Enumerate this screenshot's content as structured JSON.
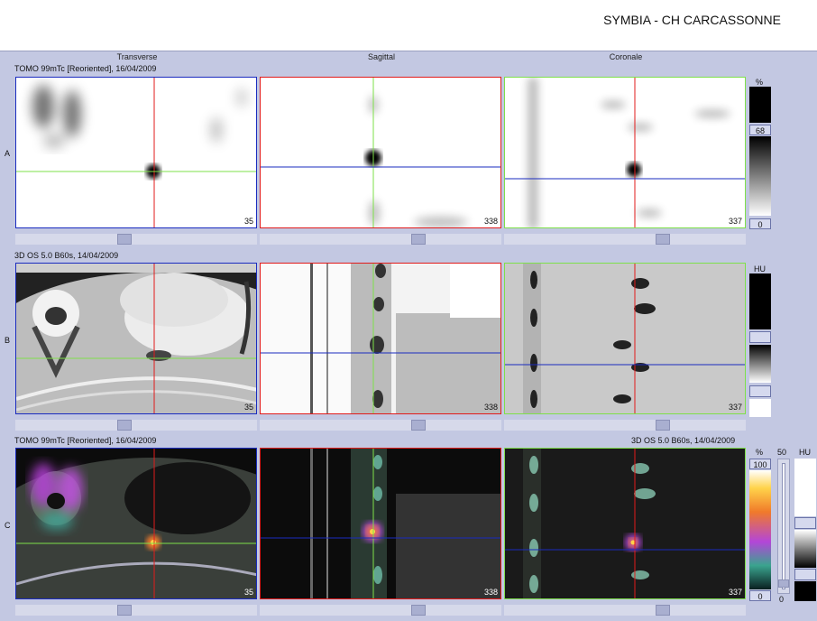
{
  "header": {
    "title": "SYMBIA - CH CARCASSONNE"
  },
  "columns": [
    "Transverse",
    "Sagittal",
    "Coronale"
  ],
  "rows": [
    {
      "label": "A",
      "series": "TOMO 99mTc [Reoriented], 16/04/2009",
      "series_right": "",
      "slices": [
        "35",
        "338",
        "337"
      ]
    },
    {
      "label": "B",
      "series": "3D  OS  5.0  B60s, 14/04/2009",
      "series_right": "",
      "slices": [
        "35",
        "338",
        "337"
      ]
    },
    {
      "label": "C",
      "series": "TOMO 99mTc [Reoriented], 16/04/2009",
      "series_right": "3D  OS  5.0  B60s, 14/04/2009",
      "slices": [
        "35",
        "338",
        "337"
      ]
    }
  ],
  "scales": {
    "a": {
      "unit": "%",
      "value": "68",
      "min": "0"
    },
    "b": {
      "unit": "HU"
    },
    "c": {
      "unit": "%",
      "max": "100",
      "min": "0",
      "blend": "50",
      "unit2": "HU",
      "blend_min": "0"
    }
  },
  "colors": {
    "crosshair_red": "#e11b1b",
    "crosshair_green": "#7ee04a",
    "crosshair_blue": "#1a2bbf"
  }
}
